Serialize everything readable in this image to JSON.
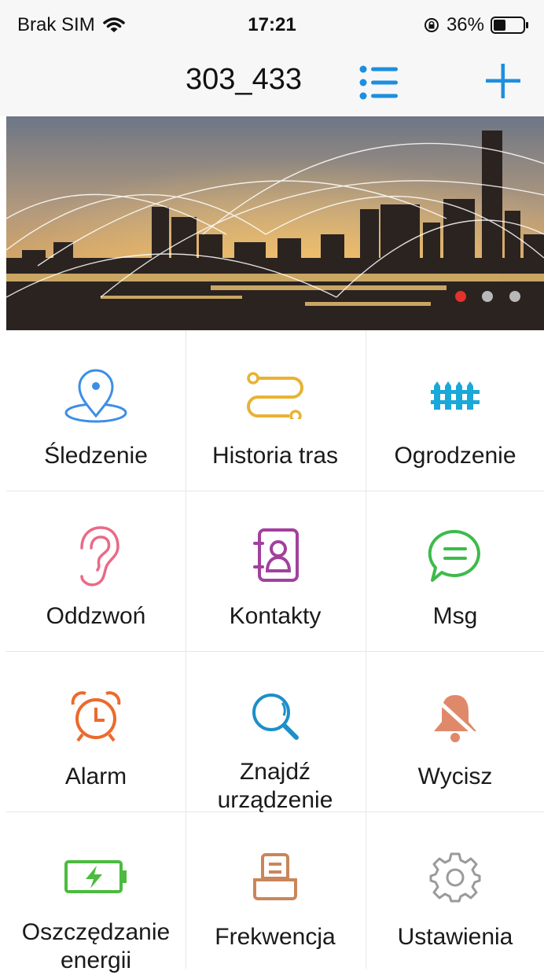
{
  "status_bar": {
    "carrier": "Brak SIM",
    "time": "17:21",
    "battery": "36%"
  },
  "nav": {
    "title": "303_433",
    "list_icon": "list-icon",
    "add_icon": "plus-icon"
  },
  "banner": {
    "active_dot": 0,
    "dot_count": 3,
    "active_color": "#e5312a",
    "inactive_color": "#b8b8b8"
  },
  "menu": [
    {
      "label": "Śledzenie",
      "icon": "location-pin-icon",
      "color": "#3d8ee6"
    },
    {
      "label": "Historia tras",
      "icon": "route-history-icon",
      "color": "#e8b234"
    },
    {
      "label": "Ogrodzenie",
      "icon": "fence-icon",
      "color": "#1aa8d8"
    },
    {
      "label": "Oddzwoń",
      "icon": "ear-icon",
      "color": "#ea6a86"
    },
    {
      "label": "Kontakty",
      "icon": "contacts-icon",
      "color": "#a2409d"
    },
    {
      "label": "Msg",
      "icon": "message-icon",
      "color": "#3dbb4a"
    },
    {
      "label": "Alarm",
      "icon": "alarm-clock-icon",
      "color": "#ec6a2d"
    },
    {
      "label": "Znajdź urządzenie",
      "icon": "search-icon",
      "color": "#1d8fc9"
    },
    {
      "label": "Wycisz",
      "icon": "bell-off-icon",
      "color": "#e0896a"
    },
    {
      "label": "Oszczędzanie energii",
      "icon": "battery-icon",
      "color": "#4cbb3f"
    },
    {
      "label": "Frekwencja",
      "icon": "attendance-icon",
      "color": "#c9865a"
    },
    {
      "label": "Ustawienia",
      "icon": "gear-icon",
      "color": "#9a9a9a"
    }
  ]
}
